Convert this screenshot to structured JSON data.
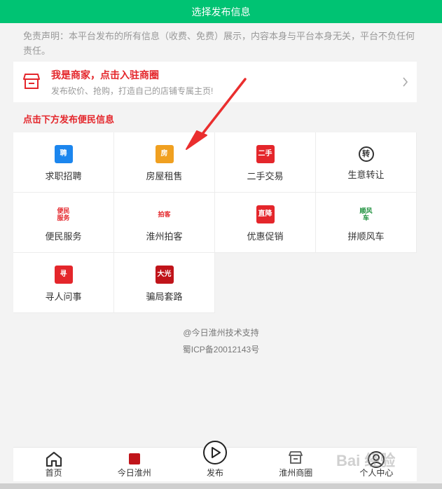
{
  "header": {
    "title": "选择发布信息"
  },
  "disclaimer": "免责声明：本平台发布的所有信息（收费、免费）展示，内容本身与平台本身无关，平台不负任何责任。",
  "merchant": {
    "title": "我是商家，点击入驻商圈",
    "subtitle": "发布砍价、抢购，打造自己的店铺专属主页!",
    "icon": "shop-icon"
  },
  "section_title": "点击下方发布便民信息",
  "categories": [
    {
      "label": "求职招聘",
      "icon": "recruit-icon",
      "icon_text": "聘",
      "color": "#1c86ee"
    },
    {
      "label": "房屋租售",
      "icon": "house-icon",
      "icon_text": "房",
      "color": "#f0a020"
    },
    {
      "label": "二手交易",
      "icon": "second-hand-icon",
      "icon_text": "二手",
      "color": "#e4262b"
    },
    {
      "label": "生意转让",
      "icon": "transfer-icon",
      "icon_text": "转",
      "color": "#333333"
    },
    {
      "label": "便民服务",
      "icon": "service-icon",
      "icon_text": "便民服务",
      "color": "#e4262b"
    },
    {
      "label": "淮州拍客",
      "icon": "paike-icon",
      "icon_text": "拍客",
      "color": "#e4262b"
    },
    {
      "label": "优惠促销",
      "icon": "promo-icon",
      "icon_text": "直降",
      "color": "#e4262b"
    },
    {
      "label": "拼顺风车",
      "icon": "carpool-icon",
      "icon_text": "顺风车",
      "color": "#1a8f3a"
    },
    {
      "label": "寻人问事",
      "icon": "search-person-icon",
      "icon_text": "寻",
      "color": "#e4262b"
    },
    {
      "label": "骗局套路",
      "icon": "scam-icon",
      "icon_text": "大光",
      "color": "#c0141a"
    }
  ],
  "footer": {
    "tech": "@今日淮州技术支持",
    "icp": "蜀ICP备20012143号"
  },
  "tabs": [
    {
      "label": "首页",
      "icon": "home-icon"
    },
    {
      "label": "今日淮州",
      "icon": "news-icon"
    },
    {
      "label": "发布",
      "icon": "publish-play-icon"
    },
    {
      "label": "淮州商圈",
      "icon": "store-icon"
    },
    {
      "label": "个人中心",
      "icon": "user-icon"
    }
  ],
  "watermark": "Bai 经验",
  "colors": {
    "brand": "#00c373",
    "accent": "#e4262b"
  }
}
